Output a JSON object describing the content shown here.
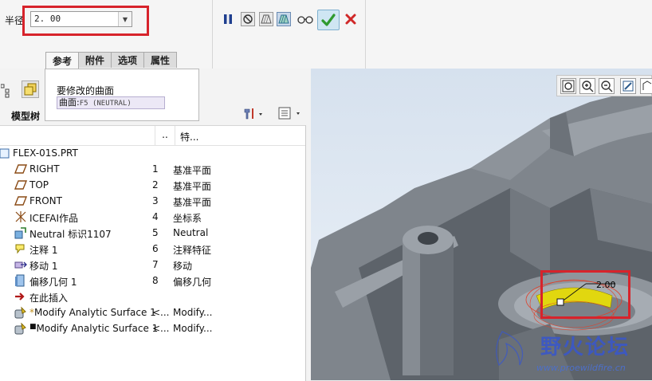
{
  "dashboard": {
    "radius_label": "半径",
    "radius_value": "2. 00",
    "tabs": [
      {
        "label": "参考",
        "active": true
      },
      {
        "label": "附件",
        "active": false
      },
      {
        "label": "选项",
        "active": false
      },
      {
        "label": "属性",
        "active": false
      }
    ],
    "icons": [
      "pause-icon",
      "stop-icon",
      "geometry-check-icon",
      "preview-icon",
      "glasses-icon",
      "check-icon",
      "close-icon"
    ]
  },
  "references": {
    "title": "要修改的曲面",
    "field_prefix": "曲面:",
    "field_value": "F5 (NEUTRAL)"
  },
  "model_tree": {
    "title": "模型树",
    "columns": {
      "dots": "..",
      "feature": "特..."
    },
    "rows": [
      {
        "name": "FLEX-01S.PRT",
        "no": "",
        "type": "",
        "icon": "part-icon"
      },
      {
        "name": "RIGHT",
        "no": "1",
        "type": "基准平面",
        "icon": "datum-plane-icon"
      },
      {
        "name": "TOP",
        "no": "2",
        "type": "基准平面",
        "icon": "datum-plane-icon"
      },
      {
        "name": "FRONT",
        "no": "3",
        "type": "基准平面",
        "icon": "datum-plane-icon"
      },
      {
        "name": "ICEFAI作品",
        "no": "4",
        "type": "坐标系",
        "icon": "coordinate-system-icon"
      },
      {
        "name": "Neutral 标识1107",
        "no": "5",
        "type": "Neutral",
        "icon": "neutral-icon"
      },
      {
        "name": "注释 1",
        "no": "6",
        "type": "注释特征",
        "icon": "annotation-icon"
      },
      {
        "name": "移动 1",
        "no": "7",
        "type": "移动",
        "icon": "move-icon"
      },
      {
        "name": "偏移几何 1",
        "no": "8",
        "type": "偏移几何",
        "icon": "offset-geometry-icon"
      },
      {
        "name": "在此插入",
        "no": "",
        "type": "",
        "icon": "insert-here-icon"
      },
      {
        "name": "Modify Analytic Surface 1",
        "no": "<...",
        "type": "Modify...",
        "icon": "modify-surface-icon"
      },
      {
        "name": "Modify Analytic Surface 1",
        "no": "<...",
        "type": "Modify...",
        "icon": "modify-surface-icon"
      }
    ]
  },
  "graphics": {
    "dimension_value": "2.00",
    "toolbar_icons": [
      "refit-icon",
      "zoom-in-icon",
      "zoom-out-icon",
      "repaint-icon",
      "view-icon"
    ],
    "watermark_text": "野火论坛",
    "watermark_url": "www.proewildfire.cn"
  },
  "colors": {
    "highlight_red": "#d7232b",
    "confirm_green": "#2f9a2f",
    "cancel_red": "#d02828",
    "surface_yellow": "#e1d70f",
    "model_gray": "#7f858c"
  }
}
